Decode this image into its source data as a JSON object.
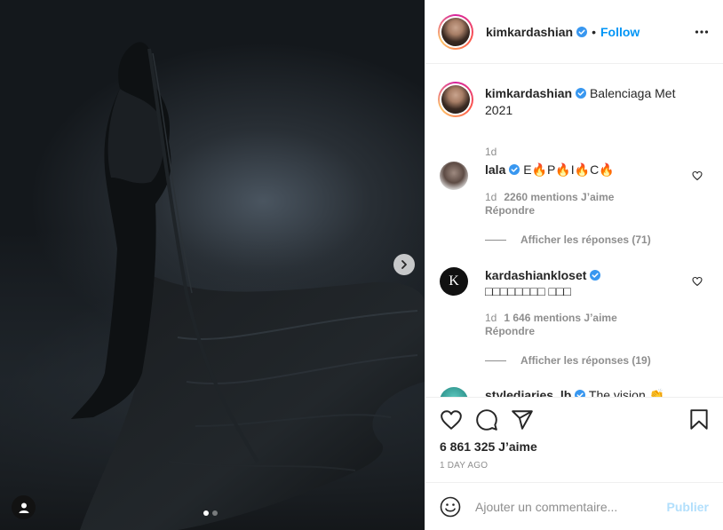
{
  "post": {
    "author": "kimkardashian",
    "follow_label": "Follow",
    "bullet": "•"
  },
  "caption": {
    "author": "kimkardashian",
    "text": "Balenciaga Met 2021",
    "time": "1d"
  },
  "comments": [
    {
      "author": "lala",
      "text": "E🔥P🔥I🔥C🔥",
      "time": "1d",
      "likes": "2260 mentions J’aime",
      "reply_label": "Répondre",
      "view_replies": "Afficher les réponses (71)"
    },
    {
      "author": "kardashiankloset",
      "text": "□□□□□□□□ □□□",
      "avatar_letter": "K",
      "time": "1d",
      "likes": "1 646 mentions J’aime",
      "reply_label": "Répondre",
      "view_replies": "Afficher les réponses (19)"
    },
    {
      "author": "stylediaries_lb",
      "text": "The vision 👏"
    }
  ],
  "actions": {
    "likes": "6 861 325 J’aime",
    "posted": "1 DAY AGO"
  },
  "composer": {
    "placeholder": "Ajouter un commentaire...",
    "publish_label": "Publier"
  },
  "carousel": {
    "current": 1,
    "total": 2
  },
  "colors": {
    "accent": "#0095f6",
    "verified": "#3897f0",
    "publish_disabled": "#b2dffc",
    "muted": "#8e8e8e"
  }
}
